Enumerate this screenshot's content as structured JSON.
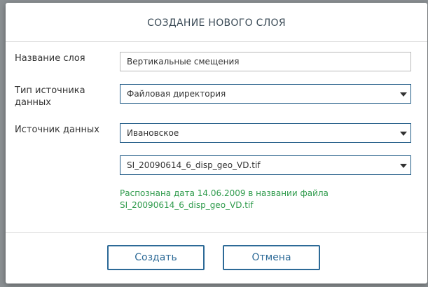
{
  "dialog": {
    "title": "СОЗДАНИЕ НОВОГО СЛОЯ",
    "layer_name": {
      "label": "Название слоя",
      "value": "Вертикальные смещения"
    },
    "source_type": {
      "label_line1": "Тип источника",
      "label_line2": "данных",
      "value": "Файловая директория"
    },
    "data_source": {
      "label": "Источник данных",
      "value": "Ивановское"
    },
    "file": {
      "value": "SI_20090614_6_disp_geo_VD.tif"
    },
    "info_line1": "Распознана дата 14.06.2009 в названии файла",
    "info_line2": "SI_20090614_6_disp_geo_VD.tif",
    "buttons": {
      "create": "Создать",
      "cancel": "Отмена"
    }
  },
  "colors": {
    "accent": "#2d6a97",
    "info_text": "#2f9b4c",
    "backdrop": "#8a8f92"
  }
}
